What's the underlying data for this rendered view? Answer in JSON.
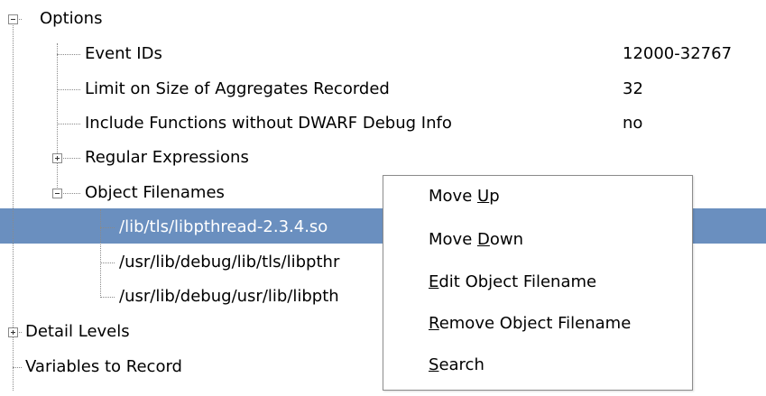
{
  "tree": {
    "options": "Options",
    "event_ids": {
      "label": "Event IDs",
      "value": "12000-32767"
    },
    "limit_size": {
      "label": "Limit on Size of Aggregates Recorded",
      "value": "32"
    },
    "include_functions": {
      "label": "Include Functions without DWARF Debug Info",
      "value": "no"
    },
    "regular_expressions": "Regular Expressions",
    "object_filenames": "Object Filenames",
    "files": [
      "/lib/tls/libpthread-2.3.4.so",
      "/usr/lib/debug/lib/tls/libpthr",
      "/usr/lib/debug/usr/lib/libpth"
    ],
    "detail_levels": "Detail Levels",
    "variables_to_record": "Variables to Record"
  },
  "menu": {
    "items": [
      {
        "pre": "Move ",
        "mn": "U",
        "post": "p"
      },
      {
        "pre": "Move ",
        "mn": "D",
        "post": "own"
      },
      {
        "pre": "",
        "mn": "E",
        "post": "dit Object Filename"
      },
      {
        "pre": "",
        "mn": "R",
        "post": "emove Object Filename"
      },
      {
        "pre": "",
        "mn": "S",
        "post": "earch"
      }
    ]
  },
  "colors": {
    "selection": "#6a8fbf",
    "guides": "#8a8a8a"
  }
}
